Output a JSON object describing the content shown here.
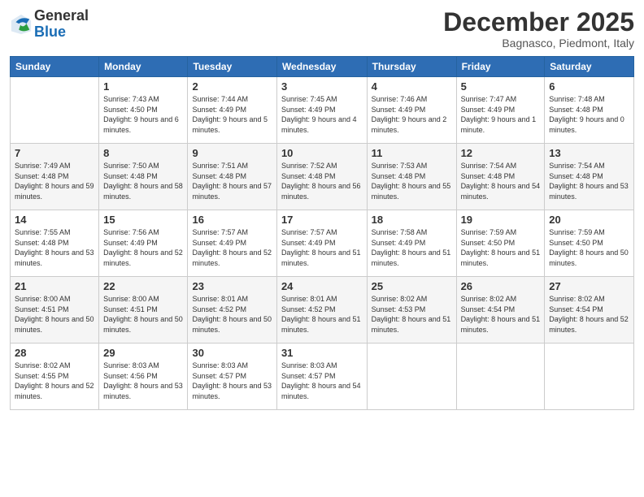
{
  "header": {
    "logo": {
      "general": "General",
      "blue": "Blue"
    },
    "title": "December 2025",
    "location": "Bagnasco, Piedmont, Italy"
  },
  "weekdays": [
    "Sunday",
    "Monday",
    "Tuesday",
    "Wednesday",
    "Thursday",
    "Friday",
    "Saturday"
  ],
  "weeks": [
    [
      {
        "day": "",
        "sunrise": "",
        "sunset": "",
        "daylight": ""
      },
      {
        "day": "1",
        "sunrise": "Sunrise: 7:43 AM",
        "sunset": "Sunset: 4:50 PM",
        "daylight": "Daylight: 9 hours and 6 minutes."
      },
      {
        "day": "2",
        "sunrise": "Sunrise: 7:44 AM",
        "sunset": "Sunset: 4:49 PM",
        "daylight": "Daylight: 9 hours and 5 minutes."
      },
      {
        "day": "3",
        "sunrise": "Sunrise: 7:45 AM",
        "sunset": "Sunset: 4:49 PM",
        "daylight": "Daylight: 9 hours and 4 minutes."
      },
      {
        "day": "4",
        "sunrise": "Sunrise: 7:46 AM",
        "sunset": "Sunset: 4:49 PM",
        "daylight": "Daylight: 9 hours and 2 minutes."
      },
      {
        "day": "5",
        "sunrise": "Sunrise: 7:47 AM",
        "sunset": "Sunset: 4:49 PM",
        "daylight": "Daylight: 9 hours and 1 minute."
      },
      {
        "day": "6",
        "sunrise": "Sunrise: 7:48 AM",
        "sunset": "Sunset: 4:48 PM",
        "daylight": "Daylight: 9 hours and 0 minutes."
      }
    ],
    [
      {
        "day": "7",
        "sunrise": "Sunrise: 7:49 AM",
        "sunset": "Sunset: 4:48 PM",
        "daylight": "Daylight: 8 hours and 59 minutes."
      },
      {
        "day": "8",
        "sunrise": "Sunrise: 7:50 AM",
        "sunset": "Sunset: 4:48 PM",
        "daylight": "Daylight: 8 hours and 58 minutes."
      },
      {
        "day": "9",
        "sunrise": "Sunrise: 7:51 AM",
        "sunset": "Sunset: 4:48 PM",
        "daylight": "Daylight: 8 hours and 57 minutes."
      },
      {
        "day": "10",
        "sunrise": "Sunrise: 7:52 AM",
        "sunset": "Sunset: 4:48 PM",
        "daylight": "Daylight: 8 hours and 56 minutes."
      },
      {
        "day": "11",
        "sunrise": "Sunrise: 7:53 AM",
        "sunset": "Sunset: 4:48 PM",
        "daylight": "Daylight: 8 hours and 55 minutes."
      },
      {
        "day": "12",
        "sunrise": "Sunrise: 7:54 AM",
        "sunset": "Sunset: 4:48 PM",
        "daylight": "Daylight: 8 hours and 54 minutes."
      },
      {
        "day": "13",
        "sunrise": "Sunrise: 7:54 AM",
        "sunset": "Sunset: 4:48 PM",
        "daylight": "Daylight: 8 hours and 53 minutes."
      }
    ],
    [
      {
        "day": "14",
        "sunrise": "Sunrise: 7:55 AM",
        "sunset": "Sunset: 4:48 PM",
        "daylight": "Daylight: 8 hours and 53 minutes."
      },
      {
        "day": "15",
        "sunrise": "Sunrise: 7:56 AM",
        "sunset": "Sunset: 4:49 PM",
        "daylight": "Daylight: 8 hours and 52 minutes."
      },
      {
        "day": "16",
        "sunrise": "Sunrise: 7:57 AM",
        "sunset": "Sunset: 4:49 PM",
        "daylight": "Daylight: 8 hours and 52 minutes."
      },
      {
        "day": "17",
        "sunrise": "Sunrise: 7:57 AM",
        "sunset": "Sunset: 4:49 PM",
        "daylight": "Daylight: 8 hours and 51 minutes."
      },
      {
        "day": "18",
        "sunrise": "Sunrise: 7:58 AM",
        "sunset": "Sunset: 4:49 PM",
        "daylight": "Daylight: 8 hours and 51 minutes."
      },
      {
        "day": "19",
        "sunrise": "Sunrise: 7:59 AM",
        "sunset": "Sunset: 4:50 PM",
        "daylight": "Daylight: 8 hours and 51 minutes."
      },
      {
        "day": "20",
        "sunrise": "Sunrise: 7:59 AM",
        "sunset": "Sunset: 4:50 PM",
        "daylight": "Daylight: 8 hours and 50 minutes."
      }
    ],
    [
      {
        "day": "21",
        "sunrise": "Sunrise: 8:00 AM",
        "sunset": "Sunset: 4:51 PM",
        "daylight": "Daylight: 8 hours and 50 minutes."
      },
      {
        "day": "22",
        "sunrise": "Sunrise: 8:00 AM",
        "sunset": "Sunset: 4:51 PM",
        "daylight": "Daylight: 8 hours and 50 minutes."
      },
      {
        "day": "23",
        "sunrise": "Sunrise: 8:01 AM",
        "sunset": "Sunset: 4:52 PM",
        "daylight": "Daylight: 8 hours and 50 minutes."
      },
      {
        "day": "24",
        "sunrise": "Sunrise: 8:01 AM",
        "sunset": "Sunset: 4:52 PM",
        "daylight": "Daylight: 8 hours and 51 minutes."
      },
      {
        "day": "25",
        "sunrise": "Sunrise: 8:02 AM",
        "sunset": "Sunset: 4:53 PM",
        "daylight": "Daylight: 8 hours and 51 minutes."
      },
      {
        "day": "26",
        "sunrise": "Sunrise: 8:02 AM",
        "sunset": "Sunset: 4:54 PM",
        "daylight": "Daylight: 8 hours and 51 minutes."
      },
      {
        "day": "27",
        "sunrise": "Sunrise: 8:02 AM",
        "sunset": "Sunset: 4:54 PM",
        "daylight": "Daylight: 8 hours and 52 minutes."
      }
    ],
    [
      {
        "day": "28",
        "sunrise": "Sunrise: 8:02 AM",
        "sunset": "Sunset: 4:55 PM",
        "daylight": "Daylight: 8 hours and 52 minutes."
      },
      {
        "day": "29",
        "sunrise": "Sunrise: 8:03 AM",
        "sunset": "Sunset: 4:56 PM",
        "daylight": "Daylight: 8 hours and 53 minutes."
      },
      {
        "day": "30",
        "sunrise": "Sunrise: 8:03 AM",
        "sunset": "Sunset: 4:57 PM",
        "daylight": "Daylight: 8 hours and 53 minutes."
      },
      {
        "day": "31",
        "sunrise": "Sunrise: 8:03 AM",
        "sunset": "Sunset: 4:57 PM",
        "daylight": "Daylight: 8 hours and 54 minutes."
      },
      {
        "day": "",
        "sunrise": "",
        "sunset": "",
        "daylight": ""
      },
      {
        "day": "",
        "sunrise": "",
        "sunset": "",
        "daylight": ""
      },
      {
        "day": "",
        "sunrise": "",
        "sunset": "",
        "daylight": ""
      }
    ]
  ]
}
